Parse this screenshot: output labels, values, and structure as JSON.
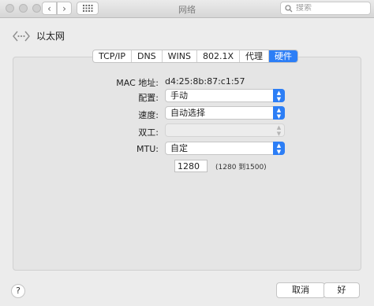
{
  "window": {
    "title": "网络"
  },
  "search": {
    "placeholder": "搜索"
  },
  "breadcrumb": {
    "label": "以太网"
  },
  "tabs": [
    {
      "label": "TCP/IP"
    },
    {
      "label": "DNS"
    },
    {
      "label": "WINS"
    },
    {
      "label": "802.1X"
    },
    {
      "label": "代理"
    },
    {
      "label": "硬件"
    }
  ],
  "hardware": {
    "mac_label": "MAC 地址:",
    "mac_value": "d4:25:8b:87:c1:57",
    "config_label": "配置:",
    "config_value": "手动",
    "speed_label": "速度:",
    "speed_value": "自动选择",
    "duplex_label": "双工:",
    "duplex_value": "",
    "mtu_label": "MTU:",
    "mtu_value": "自定",
    "mtu_input_value": "1280",
    "mtu_range": "(1280 到1500)"
  },
  "buttons": {
    "help": "?",
    "cancel": "取消",
    "ok": "好"
  },
  "colors": {
    "accent": "#2c7ef6"
  }
}
